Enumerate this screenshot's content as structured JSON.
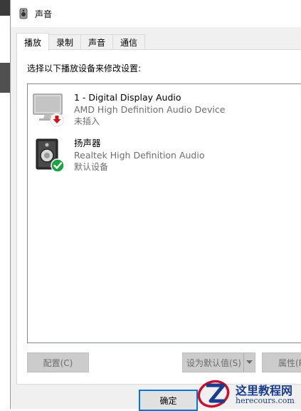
{
  "window": {
    "title": "声音"
  },
  "tabs": [
    {
      "label": "播放",
      "active": true
    },
    {
      "label": "录制",
      "active": false
    },
    {
      "label": "声音",
      "active": false
    },
    {
      "label": "通信",
      "active": false
    }
  ],
  "playback": {
    "instruction": "选择以下播放设备来修改设置:",
    "devices": [
      {
        "name": "1 - Digital Display Audio",
        "description": "AMD High Definition Audio Device",
        "status": "未插入",
        "icon": "monitor-icon",
        "badge": "unplugged-arrow-icon"
      },
      {
        "name": "扬声器",
        "description": "Realtek High Definition Audio",
        "status": "默认设备",
        "icon": "speaker-icon",
        "badge": "default-check-icon"
      }
    ]
  },
  "buttons": {
    "configure": "配置(C)",
    "set_default": "设为默认值(S)",
    "properties": "属性(P",
    "ok": "确定"
  },
  "watermark": {
    "line1": "这里教程网",
    "line2": "herecours.com"
  },
  "colors": {
    "accent": "#0078d7",
    "default_check": "#1aa340",
    "unplugged": "#d0101a"
  }
}
